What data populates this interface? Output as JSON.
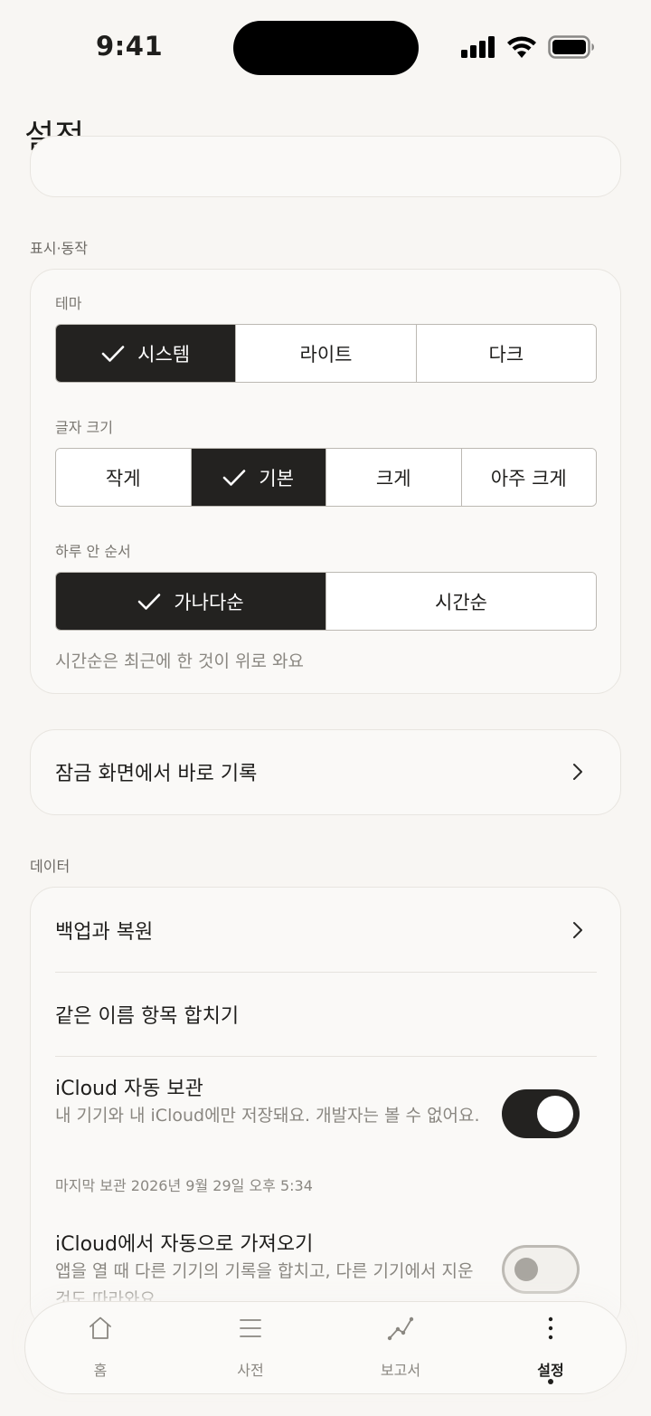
{
  "status_bar": {
    "time": "9:41"
  },
  "page_title": "설정",
  "sections": {
    "display": {
      "label": "표시·동작",
      "theme": {
        "label": "테마",
        "options": [
          "시스템",
          "라이트",
          "다크"
        ],
        "selected": "시스템"
      },
      "font_size": {
        "label": "글자 크기",
        "options": [
          "작게",
          "기본",
          "크게",
          "아주 크게"
        ],
        "selected": "기본"
      },
      "day_order": {
        "label": "하루 안 순서",
        "options": [
          "가나다순",
          "시간순"
        ],
        "selected": "가나다순",
        "hint": "시간순은 최근에 한 것이 위로 와요"
      }
    },
    "lock_screen": {
      "label": "잠금 화면에서 바로 기록"
    },
    "data": {
      "label": "데이터",
      "backup": {
        "label": "백업과 복원"
      },
      "merge": {
        "label": "같은 이름 항목 합치기"
      },
      "icloud_auto": {
        "title": "iCloud 자동 보관",
        "subtitle": "내 기기와 내 iCloud에만 저장돼요. 개발자는 볼 수 없어요.",
        "last_backup": "마지막 보관 2026년 9월 29일 오후 5:34",
        "enabled": true
      },
      "icloud_import": {
        "title": "iCloud에서 자동으로 가져오기",
        "subtitle": "앱을 열 때 다른 기기의 기록을 합치고, 다른 기기에서 지운 것도 따라와요.",
        "enabled": false
      }
    }
  },
  "tabbar": {
    "tabs": [
      {
        "label": "홈",
        "icon": "home-icon"
      },
      {
        "label": "사전",
        "icon": "list-icon"
      },
      {
        "label": "보고서",
        "icon": "chart-icon"
      },
      {
        "label": "설정",
        "icon": "more-icon",
        "active": true
      }
    ]
  }
}
